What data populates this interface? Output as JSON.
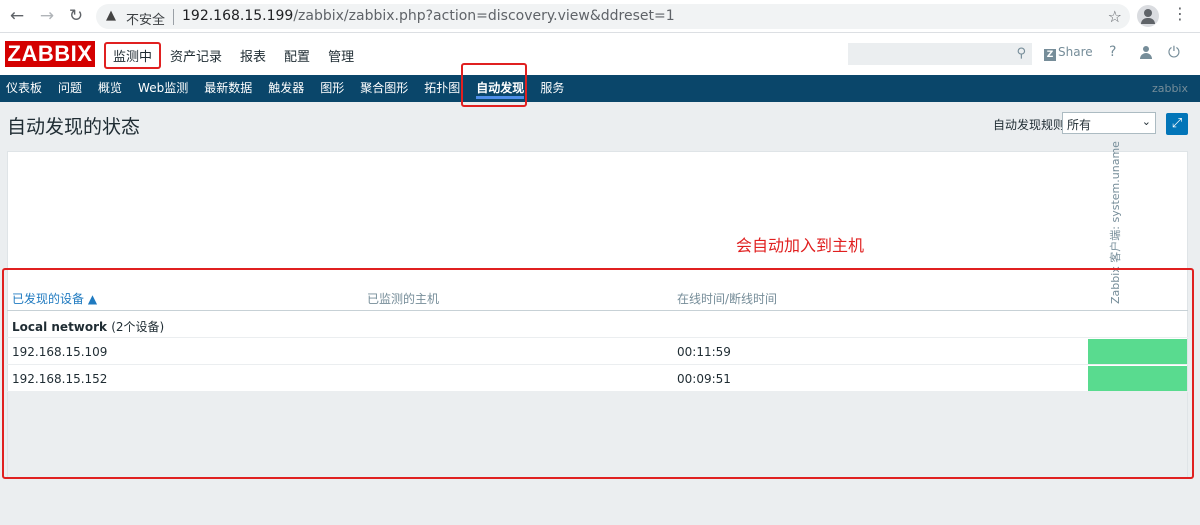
{
  "browser": {
    "insecure_label": "不安全",
    "url_host": "192.168.15.199",
    "url_path": "/zabbix/zabbix.php?action=discovery.view&ddreset=1"
  },
  "header": {
    "logo": "ZABBIX",
    "menu": [
      {
        "label": "监测中",
        "active": true
      },
      {
        "label": "资产记录"
      },
      {
        "label": "报表"
      },
      {
        "label": "配置"
      },
      {
        "label": "管理"
      }
    ],
    "share_label": "Share",
    "help_label": "?"
  },
  "subnav": {
    "items": [
      {
        "label": "仪表板"
      },
      {
        "label": "问题"
      },
      {
        "label": "概览"
      },
      {
        "label": "Web监测"
      },
      {
        "label": "最新数据"
      },
      {
        "label": "触发器"
      },
      {
        "label": "图形"
      },
      {
        "label": "聚合图形"
      },
      {
        "label": "拓扑图"
      },
      {
        "label": "自动发现",
        "active": true
      },
      {
        "label": "服务"
      }
    ],
    "server_name": "zabbix"
  },
  "page": {
    "title": "自动发现的状态",
    "filter_label": "自动发现规则",
    "filter_value": "所有"
  },
  "table": {
    "vertical_header": "Zabbix 客户端: system.uname",
    "annotation": "会自动加入到主机",
    "columns": {
      "device": "已发现的设备 ▲",
      "host": "已监测的主机",
      "uptime": "在线时间/断线时间"
    },
    "group": {
      "name": "Local network",
      "count": "(2个设备)"
    },
    "rows": [
      {
        "ip": "192.168.15.109",
        "uptime": "00:11:59"
      },
      {
        "ip": "192.168.15.152",
        "uptime": "00:09:51"
      }
    ]
  }
}
